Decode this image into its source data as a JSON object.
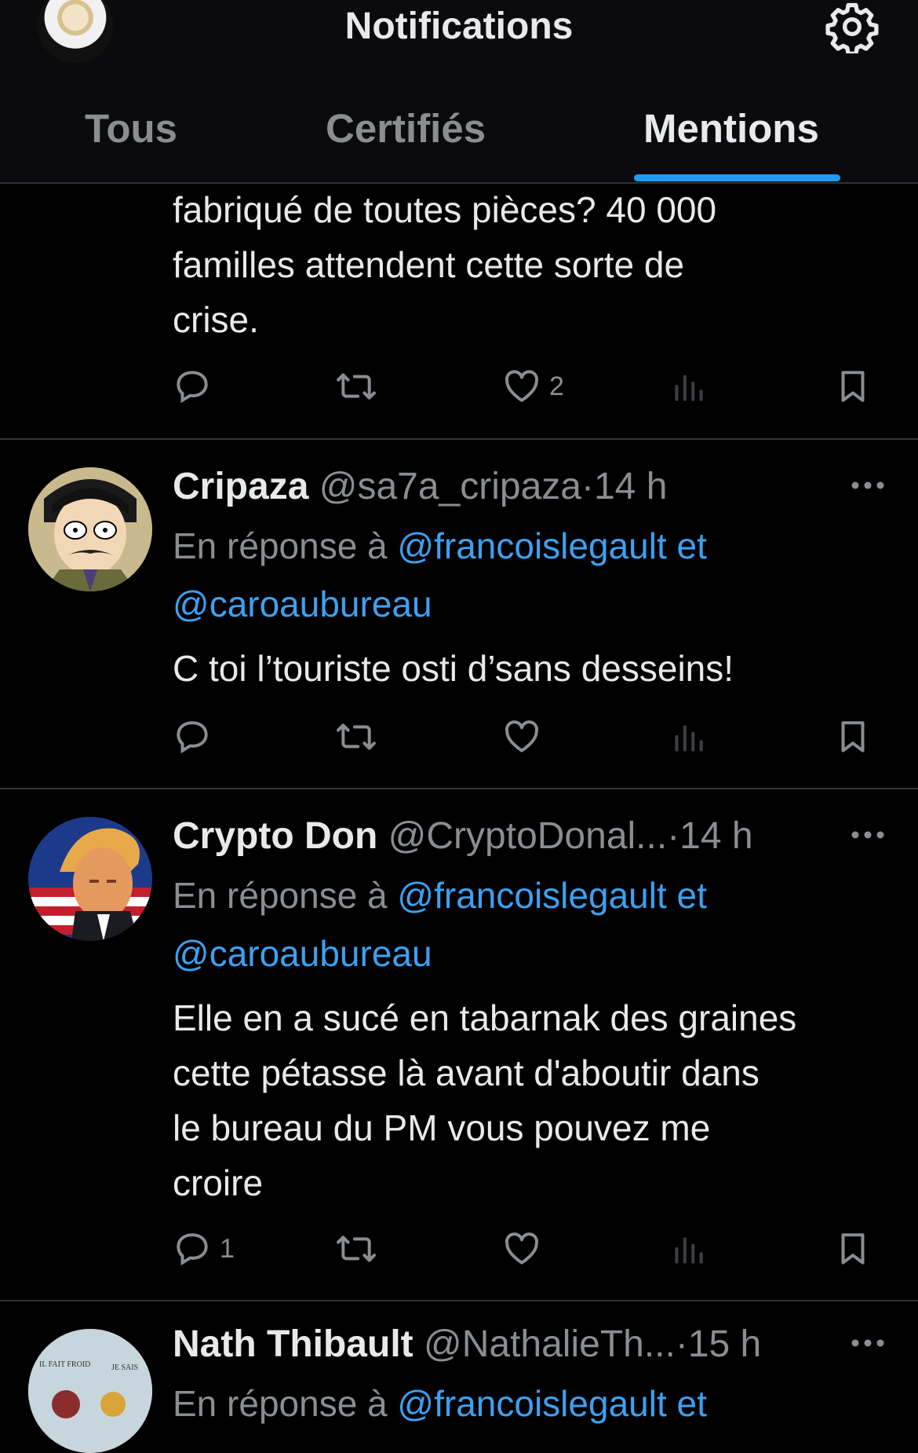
{
  "header": {
    "title": "Notifications",
    "tabs": [
      {
        "label": "Tous",
        "active": false
      },
      {
        "label": "Certifiés",
        "active": false
      },
      {
        "label": "Mentions",
        "active": true
      }
    ],
    "accent_color": "#1d9bf0",
    "settings_icon": "gear-icon"
  },
  "partial_tweet": {
    "text_lines": [
      "fabriqué de toutes pièces? 40 000",
      "familles attendent cette sorte de",
      "crise."
    ],
    "like_count": "2"
  },
  "tweets": [
    {
      "name": "Cripaza",
      "handle": "@sa7a_cripaza",
      "sep": "·",
      "time": "14 h",
      "reply_prefix": "En réponse à ",
      "reply_to_1": "@francoislegault et",
      "reply_to_2": "@caroaubureau",
      "text": "C toi l’touriste osti d’sans desseins!"
    },
    {
      "name": "Crypto Don",
      "handle": "@CryptoDonal...",
      "sep": "·",
      "time": "14 h",
      "reply_prefix": "En réponse à ",
      "reply_to_1": "@francoislegault et",
      "reply_to_2": "@caroaubureau",
      "text_lines": [
        "Elle en a sucé en tabarnak des graines",
        "cette pétasse là avant d'aboutir dans",
        "le bureau du PM vous pouvez me",
        "croire"
      ],
      "reply_count": "1"
    },
    {
      "name": "Nath Thibault",
      "handle": "@NathalieTh...",
      "sep": "·",
      "time": "15 h",
      "reply_prefix": "En réponse à ",
      "reply_to_1": "@francoislegault et"
    }
  ],
  "avatar_caption_left": "IL FAIT FROID",
  "avatar_caption_right": "JE SAIS"
}
